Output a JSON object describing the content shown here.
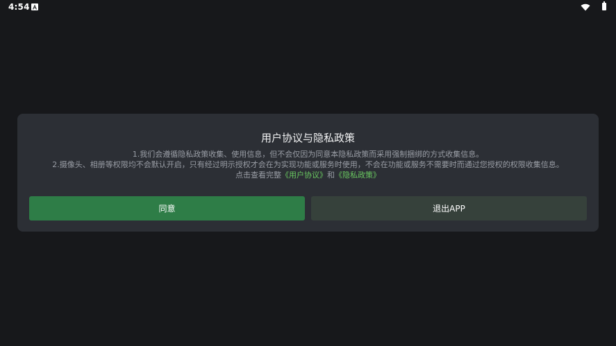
{
  "status_bar": {
    "time": "4:54",
    "icons": [
      "notification-a-icon",
      "wifi-icon",
      "battery-icon"
    ]
  },
  "dialog": {
    "title": "用户协议与隐私政策",
    "line1": "1.我们会遵循隐私政策收集、使用信息，但不会仅因为同意本隐私政策而采用强制捆绑的方式收集信息。",
    "line2": "2.摄像头、相册等权限均不会默认开启，只有经过明示授权才会在为实现功能或服务时使用，不会在功能或服务不需要时而通过您授权的权限收集信息。",
    "line3_prefix": "点击查看完整",
    "user_agreement_link": "《用户协议》",
    "and_text": "和",
    "privacy_policy_link": "《隐私政策》",
    "agree_label": "同意",
    "exit_label": "退出APP"
  },
  "colors": {
    "background": "#17181b",
    "dialog": "#2c2f35",
    "agree_button": "#2e7d47",
    "exit_button": "#36413b",
    "link": "#69c760"
  }
}
